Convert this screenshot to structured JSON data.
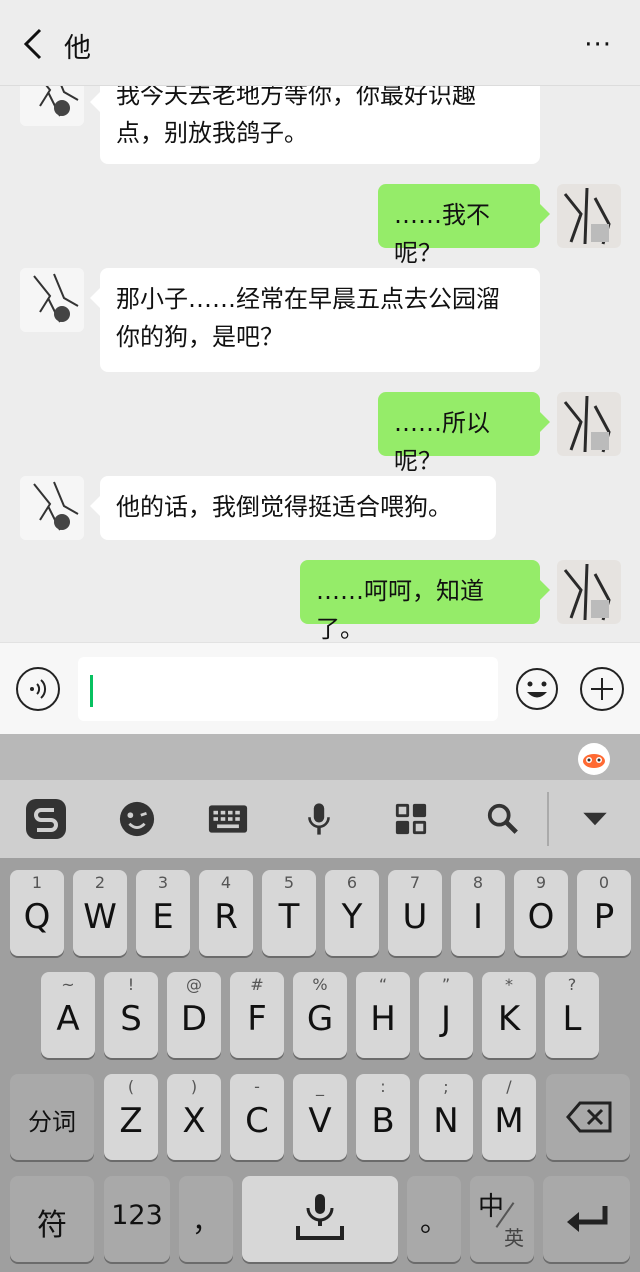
{
  "header": {
    "title": "他",
    "more": "···"
  },
  "messages": [
    {
      "side": "in",
      "lines": [
        "我今天去老地方等你，你最好识趣",
        "点，别放我鸽子。"
      ]
    },
    {
      "side": "out",
      "lines": [
        "……我不呢？"
      ]
    },
    {
      "side": "in",
      "lines": [
        "那小子……经常在早晨五点去公园溜",
        "你的狗，是吧？"
      ]
    },
    {
      "side": "out",
      "lines": [
        "……所以呢？"
      ]
    },
    {
      "side": "in",
      "lines": [
        "他的话，我倒觉得挺适合喂狗。"
      ]
    },
    {
      "side": "out",
      "lines": [
        "……呵呵，知道了。"
      ]
    }
  ],
  "input": {
    "value": ""
  },
  "toolbar": {
    "icons": [
      "sogou-logo-icon",
      "emoticon-icon",
      "keyboard-icon",
      "microphone-icon",
      "apps-icon",
      "search-icon",
      "collapse-icon"
    ]
  },
  "keyboard": {
    "row1": [
      [
        "1",
        "Q"
      ],
      [
        "2",
        "W"
      ],
      [
        "3",
        "E"
      ],
      [
        "4",
        "R"
      ],
      [
        "5",
        "T"
      ],
      [
        "6",
        "Y"
      ],
      [
        "7",
        "U"
      ],
      [
        "8",
        "I"
      ],
      [
        "9",
        "O"
      ],
      [
        "0",
        "P"
      ]
    ],
    "row2": [
      [
        "~",
        "A"
      ],
      [
        "!",
        "S"
      ],
      [
        "@",
        "D"
      ],
      [
        "#",
        "F"
      ],
      [
        "%",
        "G"
      ],
      [
        "“",
        "H"
      ],
      [
        "”",
        "J"
      ],
      [
        "*",
        "K"
      ],
      [
        "?",
        "L"
      ]
    ],
    "row3": [
      [
        "(",
        "Z"
      ],
      [
        ")",
        "X"
      ],
      [
        "-",
        "C"
      ],
      [
        "_",
        "V"
      ],
      [
        ":",
        "B"
      ],
      [
        ";",
        "N"
      ],
      [
        "/",
        "M"
      ]
    ],
    "fenci": "分词",
    "fu": "符",
    "num": "123",
    "comma": "，",
    "period": "。",
    "zh": "中",
    "en": "英"
  }
}
